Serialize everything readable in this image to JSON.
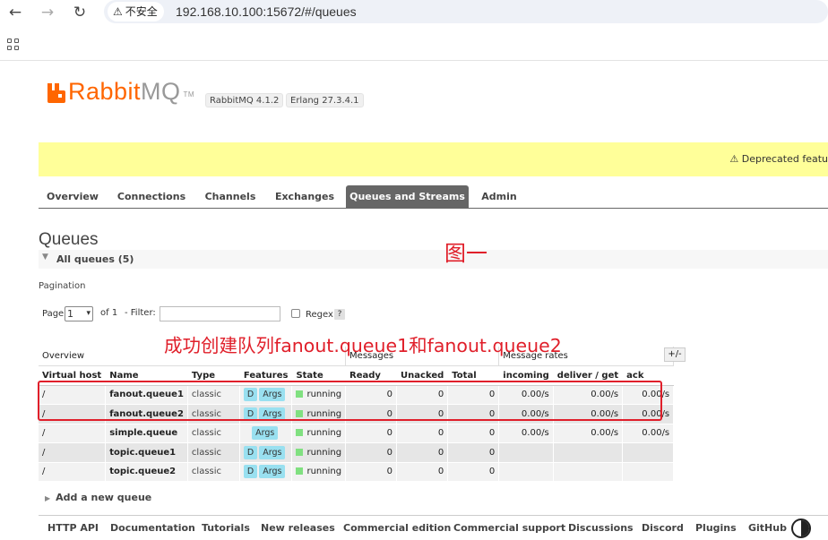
{
  "browser": {
    "security_label": "不安全",
    "url": "192.168.10.100:15672/#/queues"
  },
  "header": {
    "logo_rabbit": "Rabbit",
    "logo_mq": "MQ",
    "logo_tm": "TM",
    "rabbitmq_version": "RabbitMQ 4.1.2",
    "erlang_version": "Erlang 27.3.4.1"
  },
  "banner": {
    "text": "⚠ Deprecated featu"
  },
  "tabs": [
    {
      "label": "Overview"
    },
    {
      "label": "Connections"
    },
    {
      "label": "Channels"
    },
    {
      "label": "Exchanges"
    },
    {
      "label": "Queues and Streams"
    },
    {
      "label": "Admin"
    }
  ],
  "page": {
    "title": "Queues",
    "section_label": "All queues (5)",
    "pagination_label": "Pagination",
    "page_prefix": "Page",
    "page_value": "1",
    "of_label": "of 1",
    "filter_label": "- Filter:",
    "filter_value": "",
    "regex_label": "Regex",
    "help_label": "?",
    "toggle_cols": "+/-",
    "add_queue": "Add a new queue"
  },
  "annotations": {
    "figure_label": "图一",
    "note": "成功创建队列fanout.queue1和fanout.queue2"
  },
  "table": {
    "groups": [
      "Overview",
      "Messages",
      "Message rates"
    ],
    "columns": [
      "Virtual host",
      "Name",
      "Type",
      "Features",
      "State",
      "Ready",
      "Unacked",
      "Total",
      "incoming",
      "deliver / get",
      "ack"
    ],
    "rows": [
      {
        "vhost": "/",
        "name": "fanout.queue1",
        "type": "classic",
        "features": [
          "D",
          "Args"
        ],
        "state": "running",
        "ready": "0",
        "unacked": "0",
        "total": "0",
        "incoming": "0.00/s",
        "deliver": "0.00/s",
        "ack": "0.00/s"
      },
      {
        "vhost": "/",
        "name": "fanout.queue2",
        "type": "classic",
        "features": [
          "D",
          "Args"
        ],
        "state": "running",
        "ready": "0",
        "unacked": "0",
        "total": "0",
        "incoming": "0.00/s",
        "deliver": "0.00/s",
        "ack": "0.00/s"
      },
      {
        "vhost": "/",
        "name": "simple.queue",
        "type": "classic",
        "features": [
          "Args"
        ],
        "state": "running",
        "ready": "0",
        "unacked": "0",
        "total": "0",
        "incoming": "0.00/s",
        "deliver": "0.00/s",
        "ack": "0.00/s"
      },
      {
        "vhost": "/",
        "name": "topic.queue1",
        "type": "classic",
        "features": [
          "D",
          "Args"
        ],
        "state": "running",
        "ready": "0",
        "unacked": "0",
        "total": "0",
        "incoming": "",
        "deliver": "",
        "ack": ""
      },
      {
        "vhost": "/",
        "name": "topic.queue2",
        "type": "classic",
        "features": [
          "D",
          "Args"
        ],
        "state": "running",
        "ready": "0",
        "unacked": "0",
        "total": "0",
        "incoming": "",
        "deliver": "",
        "ack": ""
      }
    ]
  },
  "footer": [
    {
      "label": "HTTP API"
    },
    {
      "label": "Documentation"
    },
    {
      "label": "Tutorials"
    },
    {
      "label": "New releases"
    },
    {
      "label": "Commercial edition"
    },
    {
      "label": "Commercial support"
    },
    {
      "label": "Discussions"
    },
    {
      "label": "Discord"
    },
    {
      "label": "Plugins"
    },
    {
      "label": "GitHub"
    }
  ],
  "colors": {
    "brand_orange": "#ff6600",
    "banner_yellow": "#ffff99",
    "annotation_red": "#e01f2a",
    "feature_tag": "#99e0f0",
    "running_green": "#80e080"
  }
}
